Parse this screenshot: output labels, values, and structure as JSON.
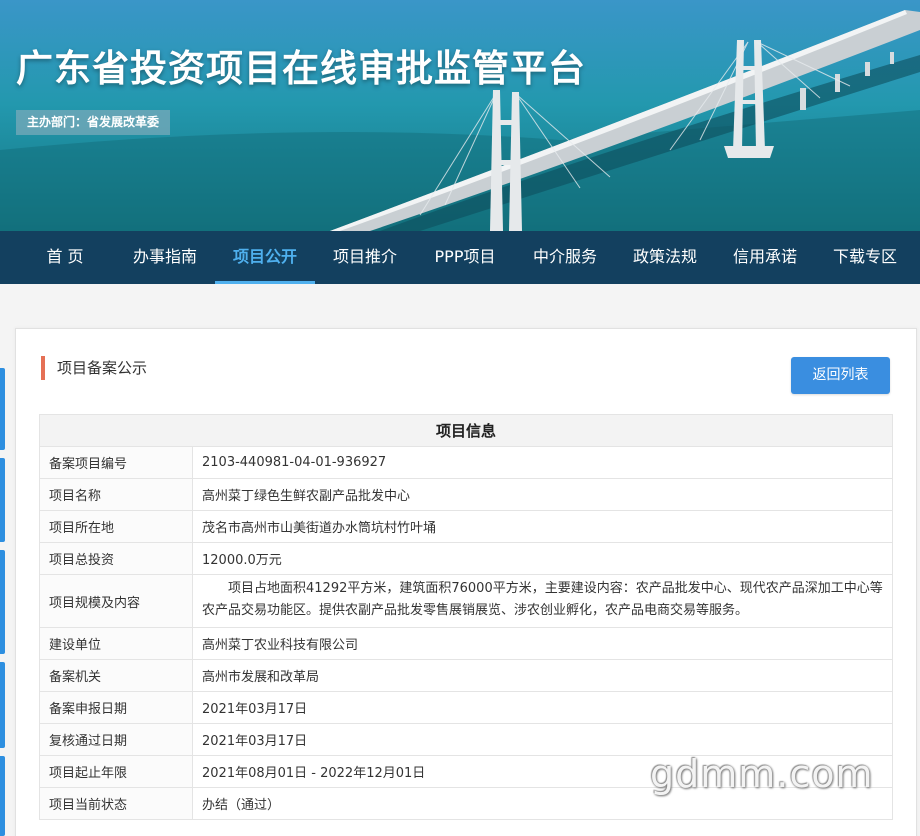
{
  "header": {
    "site_title": "广东省投资项目在线审批监管平台",
    "host_department": "主办部门：省发展改革委"
  },
  "nav": {
    "items": [
      {
        "label": "首 页",
        "active": false
      },
      {
        "label": "办事指南",
        "active": false
      },
      {
        "label": "项目公开",
        "active": true
      },
      {
        "label": "项目推介",
        "active": false
      },
      {
        "label": "PPP项目",
        "active": false
      },
      {
        "label": "中介服务",
        "active": false
      },
      {
        "label": "政策法规",
        "active": false
      },
      {
        "label": "信用承诺",
        "active": false
      },
      {
        "label": "下载专区",
        "active": false
      }
    ]
  },
  "panel": {
    "section_title": "项目备案公示",
    "back_button": "返回列表",
    "table_title": "项目信息",
    "rows": [
      {
        "label": "备案项目编号",
        "value": "2103-440981-04-01-936927"
      },
      {
        "label": "项目名称",
        "value": "高州菜丁绿色生鲜农副产品批发中心"
      },
      {
        "label": "项目所在地",
        "value": "茂名市高州市山美街道办水筒坑村竹叶埇"
      },
      {
        "label": "项目总投资",
        "value": "12000.0万元"
      },
      {
        "label": "项目规模及内容",
        "value": "项目占地面积41292平方米，建筑面积76000平方米，主要建设内容：农产品批发中心、现代农产品深加工中心等农产品交易功能区。提供农副产品批发零售展销展览、涉农创业孵化，农产品电商交易等服务。"
      },
      {
        "label": "建设单位",
        "value": "高州菜丁农业科技有限公司"
      },
      {
        "label": "备案机关",
        "value": "高州市发展和改革局"
      },
      {
        "label": "备案申报日期",
        "value": "2021年03月17日"
      },
      {
        "label": "复核通过日期",
        "value": "2021年03月17日"
      },
      {
        "label": "项目起止年限",
        "value": "2021年08月01日 - 2022年12月01日"
      },
      {
        "label": "项目当前状态",
        "value": "办结（通过）"
      }
    ]
  },
  "watermark": "gdmm.com",
  "colors": {
    "nav_bg": "#13405f",
    "nav_active": "#4fb0ee",
    "button_blue": "#3a8ee0",
    "title_accent": "#e57055"
  }
}
